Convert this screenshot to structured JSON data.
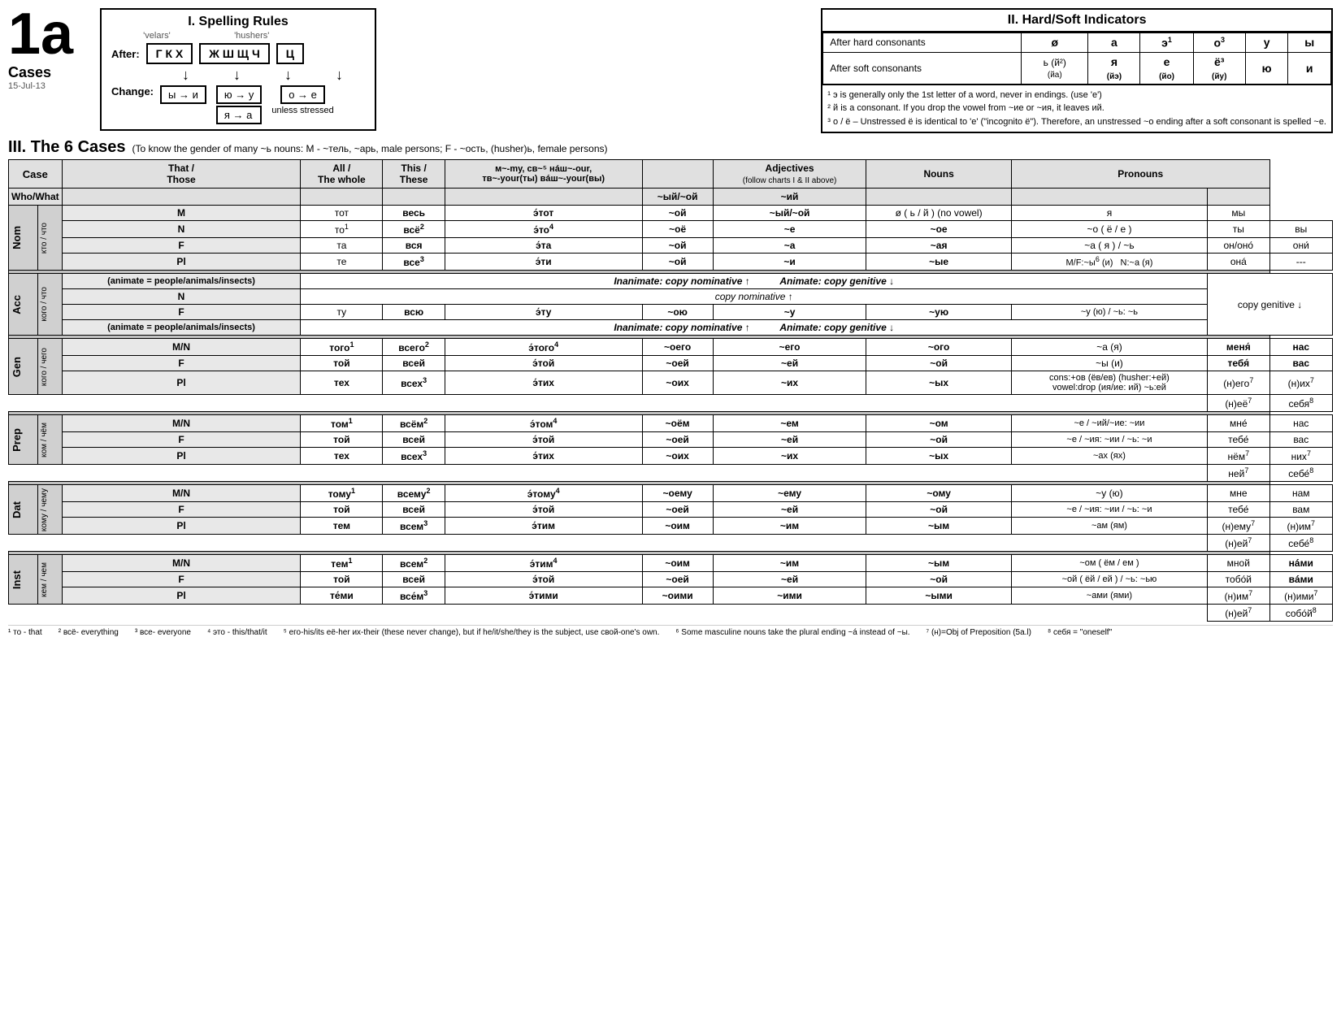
{
  "page": {
    "label": "1a",
    "date": "15-Jul-13",
    "cases_label": "Cases"
  },
  "spelling_rules": {
    "title": "I. Spelling Rules",
    "velars_label": "'velars'",
    "hushers_label": "'hushers'",
    "after_label": "After:",
    "velars": "Г К Х",
    "hushers": "Ж Ш Щ Ч",
    "ts": "Ц",
    "change_label": "Change:",
    "change1": "ы → и",
    "change2a": "ю → у",
    "change2b": "я → а",
    "change3": "о → е",
    "change3_note": "unless stressed"
  },
  "hard_soft": {
    "title": "II. Hard/Soft Indicators",
    "headers": [
      "",
      "ø",
      "а",
      "э¹",
      "о³",
      "у",
      "ы"
    ],
    "row_hard": [
      "After hard consonants",
      "ø",
      "а",
      "э¹",
      "о³",
      "у",
      "ы"
    ],
    "row_soft": [
      "After soft consonants",
      "ь (й²)",
      "я",
      "е",
      "ё³",
      "ю",
      "и"
    ],
    "row_soft_sub": [
      "",
      "(йа)",
      "(йэ)",
      "(йо)",
      "(йу)",
      "",
      ""
    ],
    "note1": "¹ э is generally only the 1st letter of a word, never in endings. (use 'e')",
    "note2": "² й is a consonant. If you drop the vowel from ~ие or ~ия, it leaves ий.",
    "note3": "³ о / ё – Unstressed ё is identical to 'е' (\"incognito ё\"). Therefore, an unstressed ~о ending after a soft consonant is spelled ~е."
  },
  "cases_section": {
    "title": "III. The 6 Cases",
    "note": "(To know the gender of many ~ь nouns: M - ~тель, ~арь, male persons; F - ~ость, (husher)ь, female persons)",
    "col_headers": [
      "Case",
      "That / Those",
      "All / The whole",
      "This / These",
      "м~-my, св~⁵ нáш~-our, тв~-your(ты) вáш~-your(вы)",
      "Adjectives (follow charts I & II above)",
      "Nouns",
      "Pronouns"
    ],
    "col_who": "Who/What",
    "col_that": "That /\nThose",
    "col_all": "All /\nThe whole",
    "col_this": "This /\nThese",
    "col_my": "м~-my, св~⁵\nнáш~-our,\nтв~-your(ты)\nвáш~-your(вы)",
    "col_adj": "Adjectives\n(follow charts I & II above)",
    "col_nouns": "Nouns",
    "col_pronouns": "Pronouns"
  },
  "footnotes": {
    "f1": "¹ то - that",
    "f2": "² всё- everything",
    "f3": "³ все- everyone",
    "f4": "⁴ это - this/that/it",
    "f5": "⁵ его-his/its её-her их-their (these never change), but if he/it/she/they is the subject, use свой-one's own.",
    "f6": "⁶ Some masculine nouns take the plural ending ~á instead of ~ы.",
    "f7": "⁷ (н)=Obj of Preposition (5a.l)",
    "f8": "⁸ себя = \"oneself\""
  }
}
